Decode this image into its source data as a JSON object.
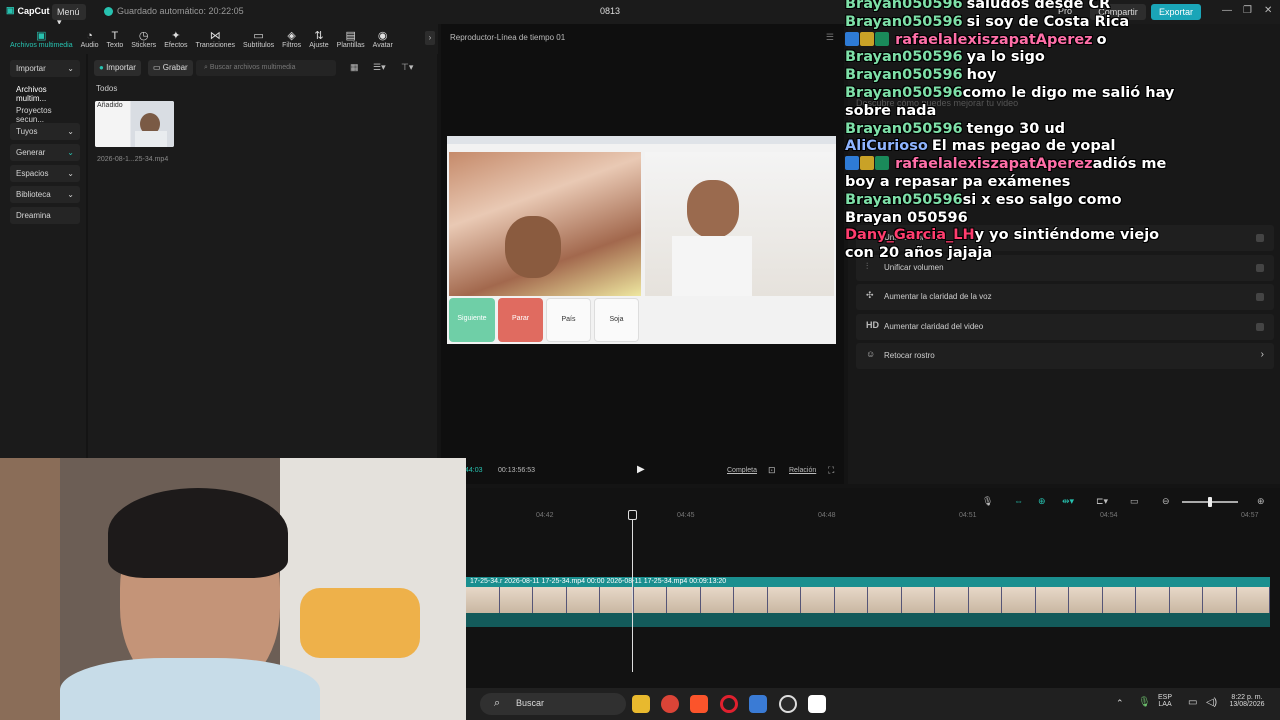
{
  "app": {
    "logo": "CapCut",
    "menu_label": "Menú",
    "autosave": "Guardado automático: 20:22:05",
    "project_title": "0813",
    "pro_label": "Pro",
    "share_label": "Compartir",
    "export_label": "Exportar"
  },
  "toolbar": {
    "items": [
      "Archivos multimedia",
      "Audio",
      "Texto",
      "Stickers",
      "Efectos",
      "Transiciones",
      "Subtítulos",
      "Filtros",
      "Ajuste",
      "Plantillas",
      "Avatar"
    ]
  },
  "leftnav": {
    "items": [
      "Importar",
      "Archivos multim...",
      "Proyectos secun...",
      "Tuyos",
      "Generar",
      "Espacios",
      "Biblioteca",
      "Dreamina"
    ]
  },
  "media": {
    "import_label": "Importar",
    "record_label": "Grabar",
    "search_placeholder": "Buscar archivos multimedia",
    "filter_label": "Todos",
    "thumb_badge": "Añadido",
    "thumb_file": "2026-08-1...25-34.mp4"
  },
  "player": {
    "title": "Reproductor-Línea de tiempo 01",
    "current_time": "44:03",
    "total_time": "00:13:56:53",
    "full_label": "Completa",
    "ratio_label": "Relación",
    "screen_buttons": [
      "Siguiente",
      "Parar",
      "País",
      "Soja"
    ]
  },
  "right_panel": {
    "faint_text": "Descubre cómo puedes mejorar tu video",
    "items": [
      {
        "label": "Unificar colores",
        "icon": "palette-icon"
      },
      {
        "label": "Unificar volumen",
        "icon": "volume-icon"
      },
      {
        "label": "Aumentar la claridad de la voz",
        "icon": "voice-icon"
      },
      {
        "label": "Aumentar claridad del video",
        "icon": "hd-icon"
      },
      {
        "label": "Retocar rostro",
        "icon": "face-icon"
      }
    ]
  },
  "chat": [
    {
      "user": "Brayan050596",
      "msg": "saludos desde CR",
      "color": "#7ee0a8",
      "badges": 0
    },
    {
      "user": "Brayan050596",
      "msg": "si soy de Costa Rica",
      "color": "#7ee0a8",
      "badges": 0
    },
    {
      "user": "rafaelalexiszapatAperez",
      "msg": "o",
      "color": "#ff6fa8",
      "badges": 3
    },
    {
      "user": "Brayan050596",
      "msg": "ya lo sigo",
      "color": "#7ee0a8",
      "badges": 0
    },
    {
      "user": "Brayan050596",
      "msg": "hoy",
      "color": "#7ee0a8",
      "badges": 0
    },
    {
      "user": "Brayan050596",
      "msg": "como le digo me salió hay sobre nada",
      "color": "#7ee0a8",
      "badges": 0
    },
    {
      "user": "Brayan050596",
      "msg": "tengo 30 ud",
      "color": "#7ee0a8",
      "badges": 0
    },
    {
      "user": "AliCurioso",
      "msg": "El mas pegao de yopal",
      "color": "#8fb4ff",
      "badges": 0
    },
    {
      "user": "rafaelalexiszapatAperez",
      "msg": "adiós me boy a repasar pa exámenes",
      "color": "#ff6fa8",
      "badges": 3
    },
    {
      "user": "Brayan050596",
      "msg": "si x eso salgo como Brayan 050596",
      "color": "#7ee0a8",
      "badges": 0
    },
    {
      "user": "Dany_Garcia_LH",
      "msg": "y yo sintiéndome viejo con 20 años jajaja",
      "color": "#ff3d6e",
      "badges": 0
    }
  ],
  "timeline": {
    "ticks": [
      "04:42",
      "04:45",
      "04:48",
      "04:51",
      "04:54",
      "04:57"
    ],
    "clip_labels": "17-25-34.r  2026-08-11 17-25-34.mp4  00:00  2026-08-11 17-25-34.mp4  00:09:13:20"
  },
  "taskbar": {
    "search_label": "Buscar",
    "lang": "ESP",
    "lang2": "LAA",
    "time": "8:22 p. m.",
    "date": "13/08/2026"
  },
  "colors": {
    "accent": "#27c2b0",
    "export": "#1aa5b8",
    "track": "#1a8f8f"
  }
}
